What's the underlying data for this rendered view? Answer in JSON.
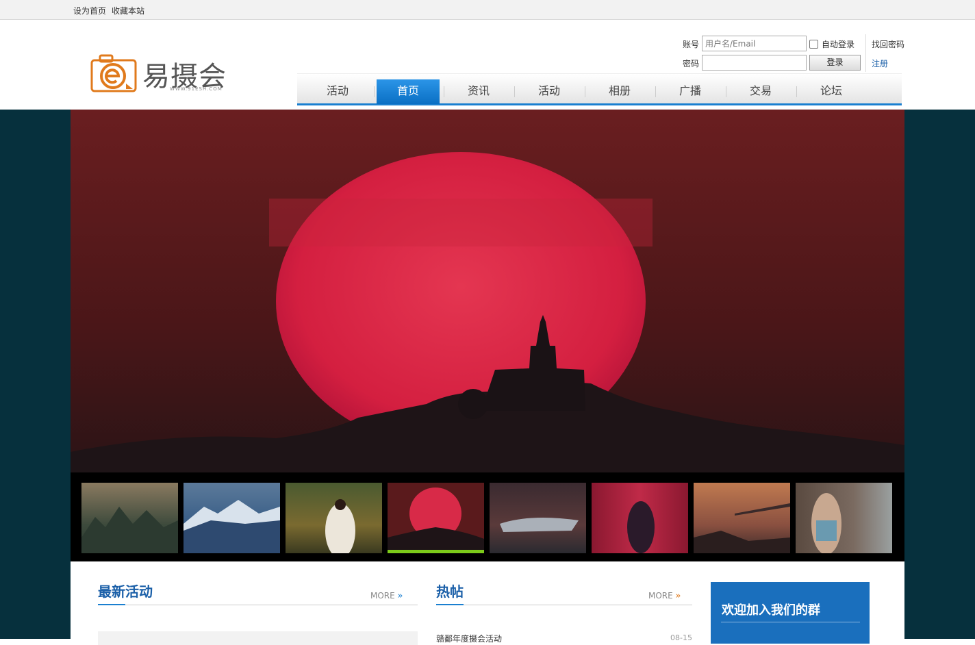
{
  "topbar": {
    "set_home": "设为首页",
    "bookmark": "收藏本站"
  },
  "logo": {
    "name": "易摄会",
    "subtitle": "WWW.91ESH.COM"
  },
  "login": {
    "account_label": "账号",
    "account_placeholder": "用户名/Email",
    "password_label": "密码",
    "auto_login": "自动登录",
    "login_button": "登录",
    "find_password": "找回密码",
    "register": "注册"
  },
  "nav": {
    "items": [
      "活动",
      "首页",
      "资讯",
      "活动",
      "相册",
      "广播",
      "交易",
      "论坛"
    ],
    "active_index": 1
  },
  "banner": {
    "active_thumb": 3,
    "thumb_count": 8
  },
  "sections": {
    "latest": {
      "title": "最新活动",
      "more": "MORE"
    },
    "hot": {
      "title": "热帖",
      "more": "MORE",
      "first_item": "赣鄱年度摄会活动",
      "first_date": "08-15"
    },
    "join": {
      "title": "欢迎加入我们的群"
    }
  },
  "colors": {
    "accent": "#1a7fd0",
    "logo_orange": "#e07a1c",
    "banner_bg": "#06303d",
    "active_thumb_bar": "#7ccb1a"
  }
}
